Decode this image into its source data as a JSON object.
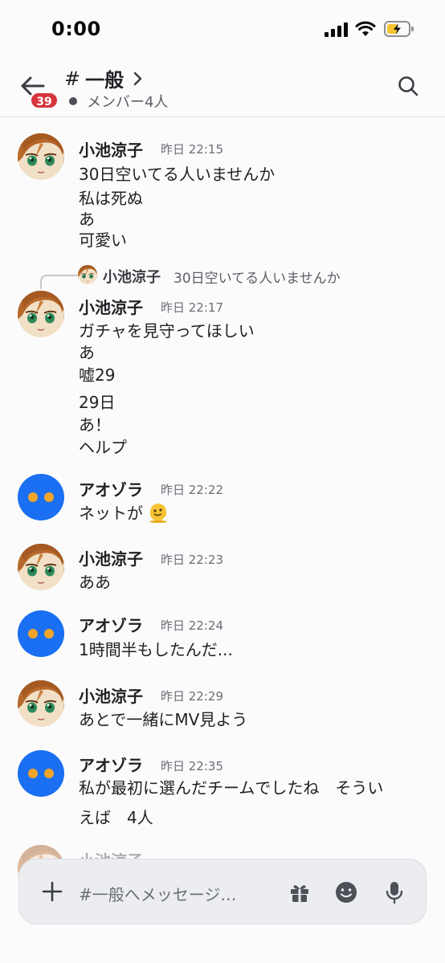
{
  "status": {
    "time": "0:00"
  },
  "header": {
    "channel_hash": "#",
    "channel_name": "一般",
    "badge_count": "39",
    "members": "メンバー4人"
  },
  "reply": {
    "author": "小池涼子",
    "text": "30日空いてる人いませんか"
  },
  "messages": [
    {
      "author": "小池涼子",
      "timestamp": "昨日 22:15",
      "lines": [
        "30日空いてる人いませんか",
        "私は死ぬ",
        "あ",
        "可愛い"
      ]
    },
    {
      "author": "小池涼子",
      "timestamp": "昨日 22:17",
      "lines": [
        "ガチャを見守ってほしい",
        "あ",
        "嘘29",
        "29日",
        "あ！",
        "ヘルプ"
      ]
    },
    {
      "author": "アオゾラ",
      "timestamp": "昨日 22:22",
      "lines": [
        "ネットが"
      ]
    },
    {
      "author": "小池涼子",
      "timestamp": "昨日 22:23",
      "lines": [
        "ああ"
      ]
    },
    {
      "author": "アオゾラ",
      "timestamp": "昨日 22:24",
      "lines": [
        "1時間半もしたんだ..."
      ]
    },
    {
      "author": "小池涼子",
      "timestamp": "昨日 22:29",
      "lines": [
        "あとで一緒にMV見よう"
      ]
    },
    {
      "author": "アオゾラ",
      "timestamp": "昨日 22:35",
      "lines": [
        "私が最初に選んだチームでしたね　そうい",
        "えば　4人"
      ]
    },
    {
      "author": "小池涼子",
      "timestamp": "",
      "lines": []
    }
  ],
  "composer": {
    "placeholder": "#一般へメッセージ…"
  },
  "colors": {
    "accent_blue": "#1a6ff2",
    "badge_red": "#d7343d",
    "avatar_dot": "#f0a42a"
  }
}
